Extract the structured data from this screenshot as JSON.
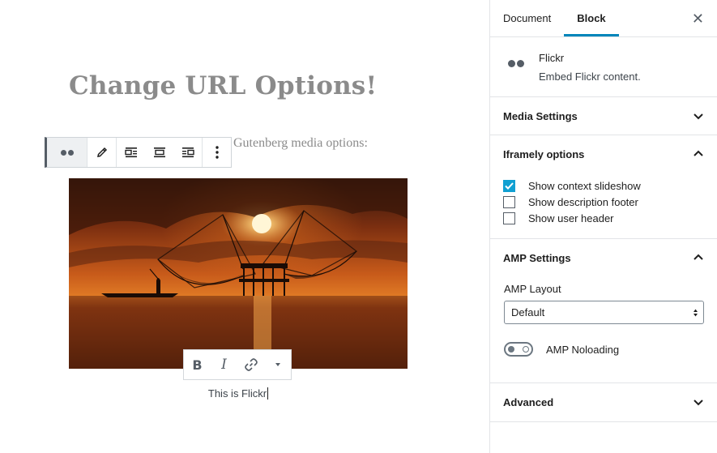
{
  "editor": {
    "post_title": "Change URL Options!",
    "paragraph_text": "Gutenberg media options:",
    "caption": "This is Flickr"
  },
  "block_toolbar": {
    "buttons": [
      "flickr-embed-icon",
      "edit-pencil-icon",
      "align-left-icon",
      "align-center-icon",
      "align-right-icon",
      "more-options-icon"
    ]
  },
  "format_toolbar": {
    "bold_label": "B",
    "italic_label": "I"
  },
  "sidebar": {
    "tabs": [
      {
        "label": "Document",
        "active": false
      },
      {
        "label": "Block",
        "active": true
      }
    ],
    "close_icon": "close-icon",
    "block_card": {
      "name": "Flickr",
      "description": "Embed Flickr content."
    },
    "panels": {
      "media_settings": {
        "title": "Media Settings",
        "open": false
      },
      "iframely": {
        "title": "Iframely options",
        "open": true,
        "options": [
          {
            "label": "Show context slideshow",
            "checked": true
          },
          {
            "label": "Show description footer",
            "checked": false
          },
          {
            "label": "Show user header",
            "checked": false
          }
        ]
      },
      "amp": {
        "title": "AMP Settings",
        "open": true,
        "layout_label": "AMP Layout",
        "layout_value": "Default",
        "noloading_label": "AMP Noloading",
        "noloading_on": false
      },
      "advanced": {
        "title": "Advanced",
        "open": false
      }
    }
  },
  "colors": {
    "accent": "#0085ba",
    "checkbox": "#11a0d2",
    "title_gray": "#8b8b8b"
  }
}
